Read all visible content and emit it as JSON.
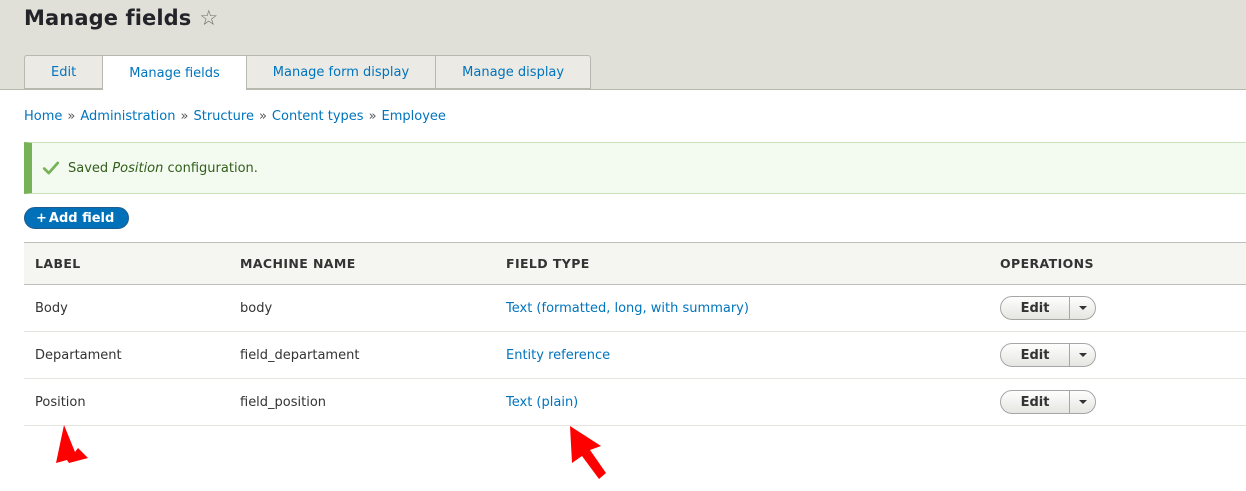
{
  "header": {
    "title": "Manage fields",
    "tabs": [
      {
        "label": "Edit",
        "active": false
      },
      {
        "label": "Manage fields",
        "active": true
      },
      {
        "label": "Manage form display",
        "active": false
      },
      {
        "label": "Manage display",
        "active": false
      }
    ]
  },
  "breadcrumb": {
    "items": [
      "Home",
      "Administration",
      "Structure",
      "Content types",
      "Employee"
    ],
    "separator": "»"
  },
  "message": {
    "prefix": "Saved ",
    "emphasis": "Position",
    "suffix": " configuration."
  },
  "actions": {
    "add_field_plus": "+",
    "add_field_label": "Add field"
  },
  "table": {
    "columns": [
      "LABEL",
      "MACHINE NAME",
      "FIELD TYPE",
      "OPERATIONS"
    ],
    "rows": [
      {
        "label": "Body",
        "machine_name": "body",
        "field_type": "Text (formatted, long, with summary)",
        "operation": "Edit"
      },
      {
        "label": "Departament",
        "machine_name": "field_departament",
        "field_type": "Entity reference",
        "operation": "Edit"
      },
      {
        "label": "Position",
        "machine_name": "field_position",
        "field_type": "Text (plain)",
        "operation": "Edit"
      }
    ]
  },
  "colors": {
    "link": "#0074bd",
    "primary_button": "#0071b8",
    "success": "#77b259",
    "annotation_arrow": "#ff0000"
  },
  "icons": [
    "star-icon",
    "check-icon",
    "plus-icon",
    "caret-down-icon",
    "red-arrow-annotation"
  ]
}
